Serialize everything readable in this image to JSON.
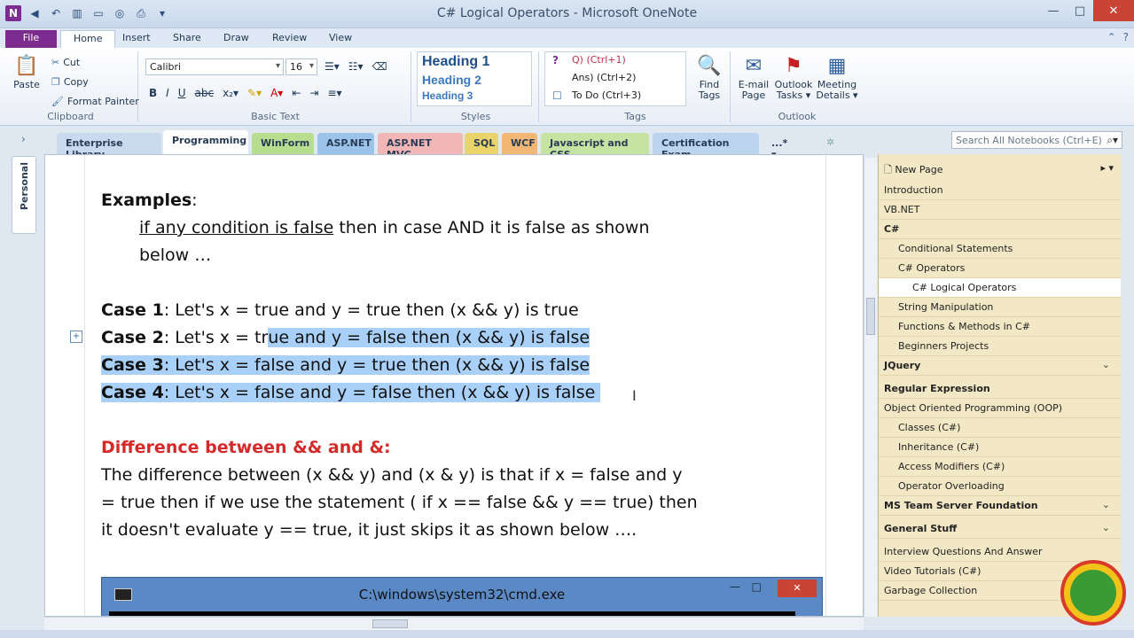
{
  "window": {
    "title": "C# Logical Operators - Microsoft OneNote",
    "app_icon": "N"
  },
  "ribbon_tabs": [
    "File",
    "Home",
    "Insert",
    "Share",
    "Draw",
    "Review",
    "View"
  ],
  "ribbon": {
    "clipboard": {
      "paste": "Paste",
      "cut": "Cut",
      "copy": "Copy",
      "format_painter": "Format Painter",
      "label": "Clipboard"
    },
    "basic_text": {
      "font": "Calibri",
      "size": "16",
      "label": "Basic Text"
    },
    "styles": {
      "h1": "Heading 1",
      "h2": "Heading 2",
      "h3": "Heading 3",
      "label": "Styles"
    },
    "tags": {
      "t1": "Q) (Ctrl+1)",
      "t2": "Ans) (Ctrl+2)",
      "t3": "To Do (Ctrl+3)",
      "find": "Find Tags",
      "label": "Tags"
    },
    "outlook": {
      "email": "E-mail Page",
      "tasks": "Outlook Tasks ▾",
      "meeting": "Meeting Details ▾",
      "label": "Outlook"
    }
  },
  "section_tabs": [
    {
      "label": "Enterprise Library",
      "color": "#c9d9ee"
    },
    {
      "label": "Programming",
      "color": "#ffffff"
    },
    {
      "label": "WinForm",
      "color": "#b7de8e"
    },
    {
      "label": "ASP.NET",
      "color": "#9cc3ea"
    },
    {
      "label": "ASP.NET MVC",
      "color": "#f3b6b6"
    },
    {
      "label": "SQL",
      "color": "#e9d36b"
    },
    {
      "label": "WCF",
      "color": "#f2b774"
    },
    {
      "label": "Javascript and CSS",
      "color": "#c6e3a1"
    },
    {
      "label": "Certification Exam",
      "color": "#bcd4ee"
    },
    {
      "label": "...* ▾",
      "color": "#dfe7f1"
    }
  ],
  "search": {
    "placeholder": "Search All Notebooks (Ctrl+E)"
  },
  "notebook": {
    "name": "Personal"
  },
  "note": {
    "examples_title": "Examples",
    "examples_colon": ":",
    "line1_u": "if any condition is false",
    "line1_rest": " then in case AND it is false as shown",
    "line2": "below …",
    "case1_label": "Case 1",
    "case1_text": ": Let's x = true and y = true then (x && y) is true",
    "case2_label": "Case 2",
    "case2_pre": ": Let's x = tr",
    "case2_hl": "ue and y = false then (x && y) is false",
    "case3_label": "Case 3",
    "case3_text": ": Let's x = false and y = true then (x && y) is false",
    "case4_label": "Case 4",
    "case4_text": ": Let's x = false and y = false then (x && y) is false",
    "diff_title": "Difference between && and &:",
    "diff_l1": "The difference between (x && y) and (x & y) is that if x = false and y",
    "diff_l2": "= true then if we use the statement ( if x == false && y == true) then",
    "diff_l3": "it doesn't evaluate y == true, it just skips it as shown below ….",
    "cmd_title": "C:\\windows\\system32\\cmd.exe"
  },
  "pages": {
    "new_page": "New Page",
    "items": [
      {
        "label": "Introduction",
        "level": 0
      },
      {
        "label": "VB.NET",
        "level": 0
      },
      {
        "label": "C#",
        "level": 0,
        "bold": true
      },
      {
        "label": "Conditional Statements",
        "level": 1
      },
      {
        "label": "C# Operators",
        "level": 1
      },
      {
        "label": "C# Logical Operators",
        "level": 2,
        "selected": true
      },
      {
        "label": "String Manipulation",
        "level": 1
      },
      {
        "label": "Functions & Methods in C#",
        "level": 1
      },
      {
        "label": "Beginners Projects",
        "level": 1
      },
      {
        "label": "JQuery",
        "level": 0,
        "bold": true,
        "chevron": "⌄"
      },
      {
        "label": "Regular Expression",
        "level": 0,
        "bold": true
      },
      {
        "label": "Object Oriented Programming (OOP)",
        "level": 0
      },
      {
        "label": "Classes (C#)",
        "level": 1
      },
      {
        "label": "Inheritance (C#)",
        "level": 1
      },
      {
        "label": "Access Modifiers (C#)",
        "level": 1
      },
      {
        "label": "Operator Overloading",
        "level": 1
      },
      {
        "label": "MS Team Server Foundation",
        "level": 0,
        "bold": true,
        "chevron": "⌄"
      },
      {
        "label": "General Stuff",
        "level": 0,
        "bold": true,
        "chevron": "⌄"
      },
      {
        "label": "Interview Questions And Answer",
        "level": 0
      },
      {
        "label": "Video Tutorials (C#)",
        "level": 0
      },
      {
        "label": "Garbage Collection",
        "level": 0
      }
    ]
  }
}
